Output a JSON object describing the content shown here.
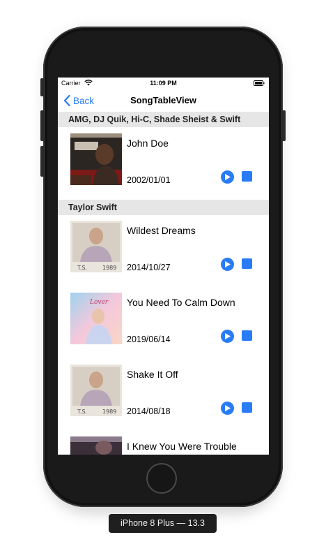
{
  "status_bar": {
    "carrier": "Carrier",
    "time": "11:09 PM"
  },
  "nav": {
    "back_label": "Back",
    "title": "SongTableView"
  },
  "sections": [
    {
      "header": "AMG, DJ Quik, Hi-C, Shade Sheist & Swift",
      "songs": [
        {
          "title": "John Doe",
          "date": "2002/01/01"
        }
      ]
    },
    {
      "header": "Taylor Swift",
      "songs": [
        {
          "title": "Wildest Dreams",
          "date": "2014/10/27"
        },
        {
          "title": "You Need To Calm Down",
          "date": "2019/06/14"
        },
        {
          "title": "Shake It Off",
          "date": "2014/08/18"
        },
        {
          "title": "I Knew You Were Trouble",
          "date": ""
        }
      ]
    }
  ],
  "device_label": "iPhone 8 Plus — 13.3",
  "colors": {
    "accent": "#2a7bf6",
    "section_bg": "#e6e6e6",
    "bezel": "#1a1a1a"
  },
  "icons": {
    "play": "play-circle-icon",
    "stop": "stop-square-icon",
    "back": "chevron-left-icon"
  }
}
